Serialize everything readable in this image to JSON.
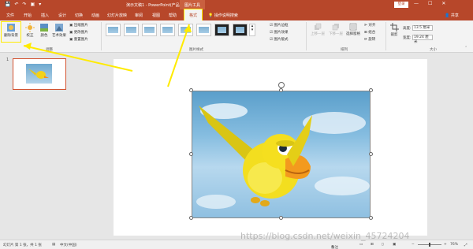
{
  "titlebar": {
    "qat": [
      "💾",
      "↶",
      "↷",
      "▣",
      "▾"
    ],
    "doc_title": "演示文稿1 - PowerPoint(产品激活失败)",
    "context_tools": "图片工具",
    "login": "登录",
    "win_min": "—",
    "win_max": "☐",
    "win_close": "✕"
  },
  "tabs": {
    "file": "文件",
    "home": "开始",
    "insert": "插入",
    "design": "设计",
    "transitions": "切换",
    "animations": "动画",
    "slideshow": "幻灯片放映",
    "review": "审阅",
    "view": "视图",
    "help": "帮助",
    "format": "格式",
    "tell_me": "操作说明搜索",
    "share": "共享"
  },
  "ribbon": {
    "remove_bg": "删除背景",
    "corrections": "校正",
    "color": "颜色",
    "artistic": "艺术效果",
    "compress": "压缩图片",
    "change_pic": "更改图片",
    "reset_pic": "重置图片",
    "adjust_label": "调整",
    "picture_border": "图片边框",
    "picture_effects": "图片效果",
    "picture_layout": "图片版式",
    "styles_label": "图片样式",
    "bring_forward": "上移一层",
    "send_backward": "下移一层",
    "selection_pane": "选择窗格",
    "align": "对齐",
    "group": "组合",
    "rotate": "旋转",
    "arrange_label": "排列",
    "crop": "裁剪",
    "height_label": "高度:",
    "height_value": "13.5 厘米",
    "width_label": "宽度:",
    "width_value": "19.24 厘米",
    "size_label": "大小"
  },
  "slides": {
    "slide_number": "1"
  },
  "status": {
    "slide_info": "幻灯片 第 1 张，共 1 张",
    "language": "中文(中国)",
    "notes": "备注",
    "zoom": "76%"
  },
  "watermark": "https://blog.csdn.net/weixin_45724204",
  "colors": {
    "accent": "#b7472a",
    "highlight": "#ffeb00"
  }
}
